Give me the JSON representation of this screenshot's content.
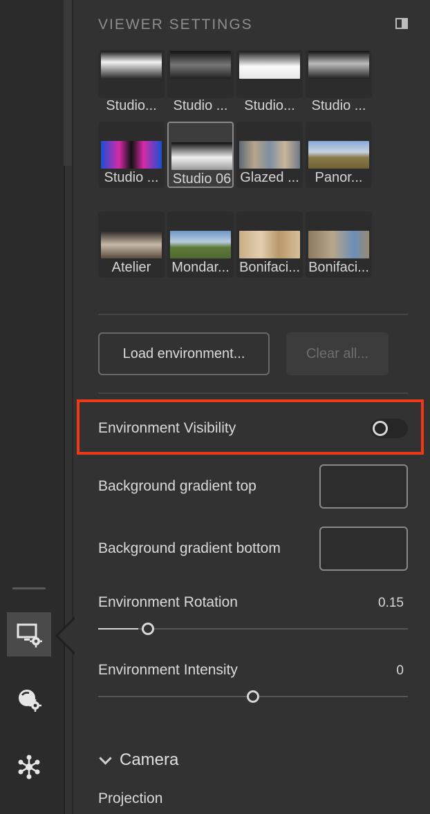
{
  "header": {
    "title": "VIEWER SETTINGS"
  },
  "environments": [
    {
      "label": "Studio...",
      "bg": "linear-gradient(180deg,#1a1a1a 0%,#f2f2f2 40%,#2a2a2a 100%)"
    },
    {
      "label": "Studio ...",
      "bg": "linear-gradient(180deg,#111 0%,#777 50%,#222 100%)"
    },
    {
      "label": "Studio...",
      "bg": "linear-gradient(180deg,#1c1c1c 0%,#fafafa 55%,#e8e8e8 100%)"
    },
    {
      "label": "Studio ...",
      "bg": "linear-gradient(180deg,#111 0%,#bbb 45%,#222 100%)"
    },
    {
      "label": "Studio ...",
      "bg": "linear-gradient(90deg,#1a4fd6 0%,#d62aa8 30%,#111 50%,#d62aa8 70%,#1a4fd6 100%)"
    },
    {
      "label": "Studio 06",
      "bg": "linear-gradient(180deg,#0e0e0e 0%,#f0f0f0 55%,#9a9a9a 100%)"
    },
    {
      "label": "Glazed ...",
      "bg": "linear-gradient(90deg,#5d6a78 0%,#b7a58a 25%,#7e8fa2 50%,#c9b59a 75%,#6f7b88 100%)"
    },
    {
      "label": "Panor...",
      "bg": "linear-gradient(180deg,#87a9d8 0%,#c6d3e0 40%,#8a7a48 60%,#6f6236 100%)"
    },
    {
      "label": "Atelier",
      "bg": "linear-gradient(180deg,#2a2522 0%,#c7b9a8 50%,#5a4b3f 100%)"
    },
    {
      "label": "Mondar...",
      "bg": "linear-gradient(180deg,#6d97c4 0%,#b9cde0 40%,#5e7a3a 60%,#4f6a2e 100%)"
    },
    {
      "label": "Bonifaci...",
      "bg": "linear-gradient(90deg,#c9ad86 0%,#e3cfae 35%,#b9976c 65%,#d7bf98 100%)"
    },
    {
      "label": "Bonifaci...",
      "bg": "linear-gradient(90deg,#8a7a62 0%,#b9a68a 40%,#6b8fb7 75%,#9a8a70 100%)"
    }
  ],
  "selected_environment": "Studio 06",
  "buttons": {
    "load": "Load environment...",
    "clear": "Clear all..."
  },
  "visibility": {
    "label": "Environment Visibility",
    "on": false
  },
  "bg_top": {
    "label": "Background gradient top"
  },
  "bg_bottom": {
    "label": "Background gradient bottom"
  },
  "rotation": {
    "label": "Environment Rotation",
    "value": "0.15",
    "fraction": 0.16
  },
  "intensity": {
    "label": "Environment Intensity",
    "value": "0",
    "fraction": 0.5
  },
  "camera": {
    "label": "Camera",
    "projection_label": "Projection"
  },
  "colors": {
    "highlight": "#f03a17"
  },
  "rail": {
    "icons": [
      "viewer-settings-icon",
      "material-settings-icon",
      "scene-graph-icon"
    ],
    "active": "viewer-settings-icon"
  }
}
